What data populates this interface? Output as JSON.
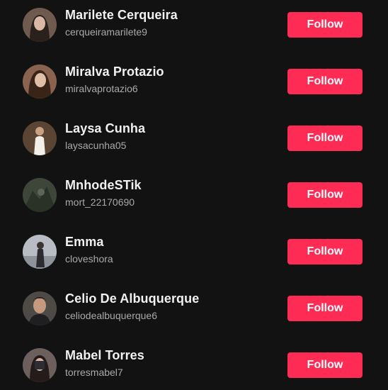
{
  "accent_color": "#fe2c55",
  "background_color": "#121212",
  "users": [
    {
      "name": "Marilete Cerqueira",
      "username": "cerqueiramarilete9",
      "button": "Follow",
      "avatar_tone": "#6e5a4e"
    },
    {
      "name": "Miralva Protazio",
      "username": "miralvaprotazio6",
      "button": "Follow",
      "avatar_tone": "#8a6250"
    },
    {
      "name": "Laysa Cunha",
      "username": "laysacunha05",
      "button": "Follow",
      "avatar_tone": "#5a4534"
    },
    {
      "name": "MnhodeSTik",
      "username": "mort_22170690",
      "button": "Follow",
      "avatar_tone": "#3d4638"
    },
    {
      "name": "Emma",
      "username": "cloveshora",
      "button": "Follow",
      "avatar_tone": "#b9bcc4"
    },
    {
      "name": "Celio De Albuquerque",
      "username": "celiodealbuquerque6",
      "button": "Follow",
      "avatar_tone": "#4e4a46"
    },
    {
      "name": "Mabel Torres",
      "username": "torresmabel7",
      "button": "Follow",
      "avatar_tone": "#6d5f5c"
    }
  ]
}
